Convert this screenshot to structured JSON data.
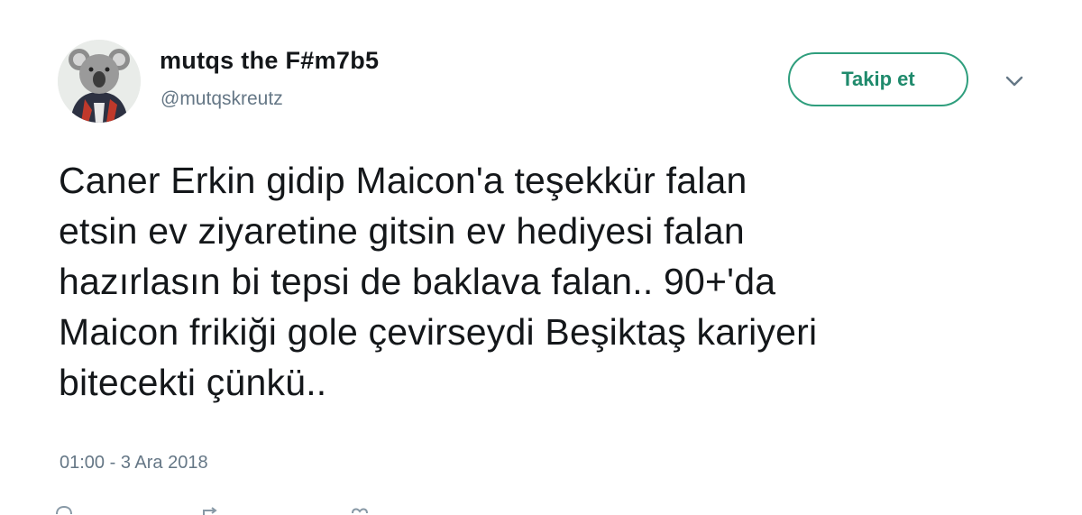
{
  "user": {
    "display_name": "mutqs the F#m7b5",
    "handle": "@mutqskreutz",
    "avatar_icon": "koala-avatar-icon"
  },
  "follow": {
    "label": "Takip et",
    "color": "#2f9e7d"
  },
  "menu": {
    "icon": "chevron-down-icon"
  },
  "tweet": {
    "lines": [
      "Caner Erkin gidip Maicon'a teşekkür falan",
      "etsin ev ziyaretine gitsin ev hediyesi falan",
      "hazırlasın bi tepsi de baklava falan.. 90+'da",
      "Maicon frikiği gole çevirseydi Beşiktaş kariyeri",
      "bitecekti çünkü.."
    ],
    "timestamp": "01:00 - 3 Ara 2018"
  },
  "actions": {
    "icons": [
      "reply-icon",
      "retweet-icon",
      "like-icon"
    ]
  }
}
